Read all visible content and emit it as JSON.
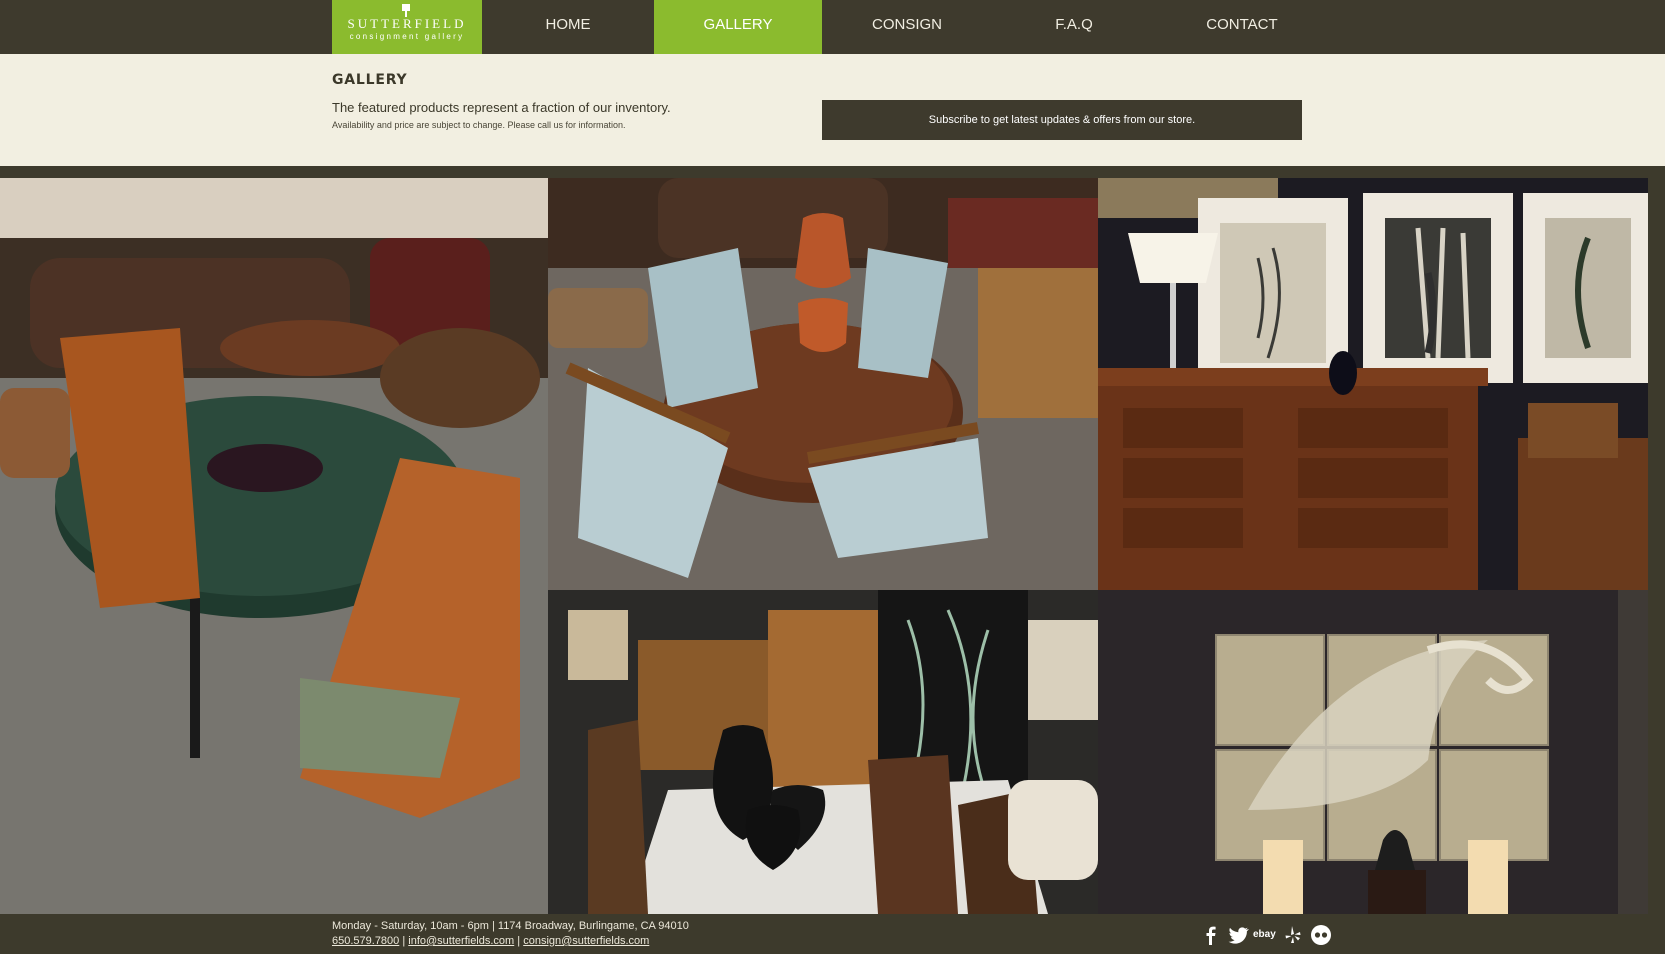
{
  "nav": {
    "logo_title": "SUTTERFIELD",
    "logo_subtitle": "consignment gallery",
    "items": [
      {
        "label": "HOME"
      },
      {
        "label": "GALLERY"
      },
      {
        "label": "CONSIGN"
      },
      {
        "label": "F.A.Q"
      },
      {
        "label": "CONTACT"
      }
    ],
    "active_color": "#8bbb2e"
  },
  "header": {
    "title": "GALLERY",
    "lead": "The featured products represent a fraction of our inventory.",
    "note": "Availability and price are subject to change. Please call us for information.",
    "subscribe_label": "Subscribe to get latest updates & offers from our store."
  },
  "gallery": {
    "tiles": [
      {
        "subject": "green marble dining table with chairs"
      },
      {
        "subject": "round wood dining table with vases"
      },
      {
        "subject": "wood dresser with framed botanical prints"
      },
      {
        "subject": "black vases on marble table with screen"
      },
      {
        "subject": "leaf wall art panels with lamps"
      }
    ]
  },
  "footer": {
    "hours": "Monday - Saturday, 10am - 6pm | 1174 Broadway, Burlingame, CA 94010",
    "phone": "650.579.7800",
    "sep": "|",
    "email_info": "info@sutterfields.com",
    "email_consign": "consign@sutterfields.com",
    "social": [
      "facebook-icon",
      "twitter-icon",
      "ebay-icon",
      "yelp-icon",
      "flickr-icon"
    ],
    "ebay_text": "ebay"
  },
  "colors": {
    "dark": "#3e3a2d",
    "cream": "#f2efe1",
    "green": "#8bbb2e"
  }
}
